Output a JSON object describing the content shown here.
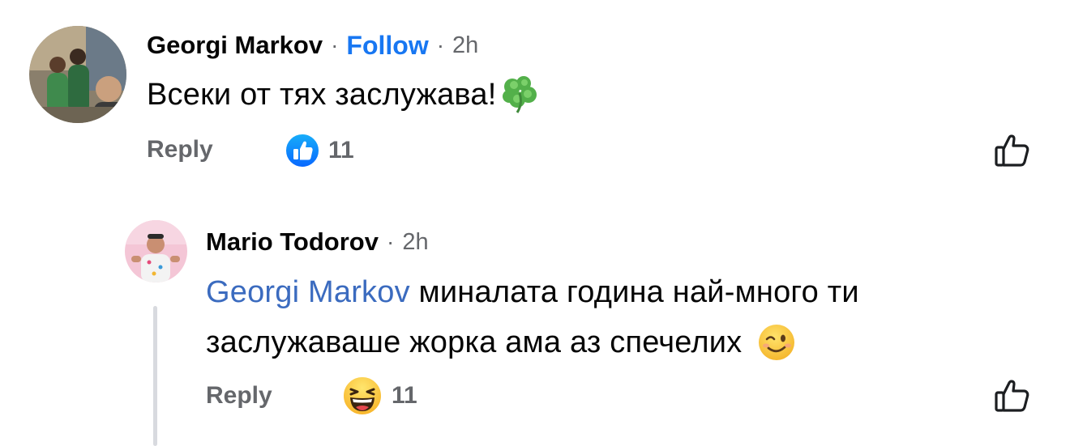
{
  "comments": [
    {
      "author": "Georgi Markov",
      "separator": "·",
      "follow_label": "Follow",
      "time": "2h",
      "text": "Всеки от тях заслужава!",
      "text_emoji": "🍀",
      "reply_label": "Reply",
      "reaction_type": "like",
      "reaction_count": "11"
    },
    {
      "author": "Mario Todorov",
      "separator": "·",
      "time": "2h",
      "mention": "Georgi Markov",
      "text_line1": " миналата година най-много ти",
      "text_line2": "заслужаваше жорка ама аз спечелих",
      "text_emoji": "😉",
      "reply_label": "Reply",
      "reaction_type": "haha",
      "reaction_count": "11"
    }
  ],
  "colors": {
    "follow": "#1877f2",
    "mention": "#3b6bbf",
    "muted": "#65676b",
    "like_blue": "#1877f2"
  },
  "icons": [
    "like-reaction-icon",
    "haha-reaction-icon",
    "thumbs-up-outline-icon",
    "four-leaf-clover-icon",
    "winking-face-icon"
  ]
}
